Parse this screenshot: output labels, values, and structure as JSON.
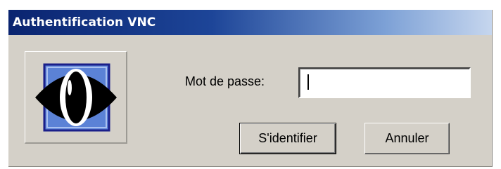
{
  "window": {
    "title": "Authentification VNC"
  },
  "icon": {
    "name": "vnc-eye-icon"
  },
  "password": {
    "label": "Mot de passe:",
    "value": ""
  },
  "buttons": {
    "login_label": "S'identifier",
    "cancel_label": "Annuler"
  },
  "colors": {
    "title_gradient_start": "#0a2470",
    "title_gradient_end": "#c6d6ee",
    "dialog_background": "#d4d0c8",
    "icon_tile": "#5b82d6"
  }
}
